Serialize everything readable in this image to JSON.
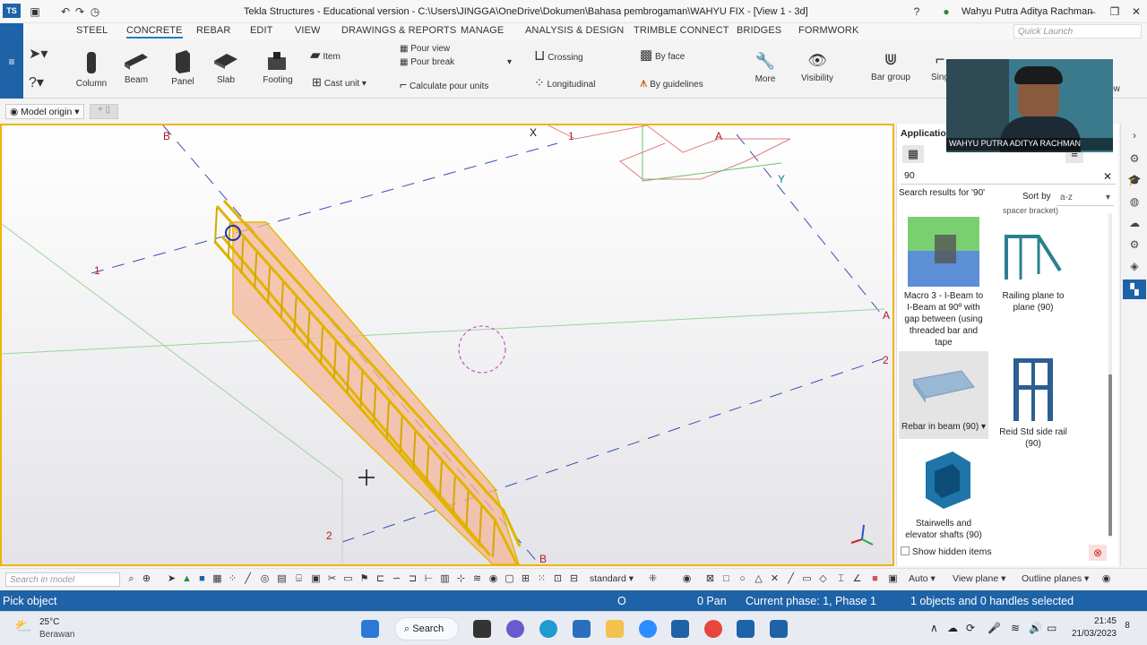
{
  "window": {
    "title": "Tekla Structures - Educational version - C:\\Users\\JINGGA\\OneDrive\\Dokumen\\Bahasa pembrogaman\\WAHYU FIX  - [View 1 - 3d]",
    "user": "Wahyu Putra Aditya Rachman"
  },
  "ribbon_tabs": [
    "STEEL",
    "CONCRETE",
    "REBAR",
    "EDIT",
    "VIEW",
    "DRAWINGS & REPORTS",
    "MANAGE",
    "ANALYSIS & DESIGN",
    "TRIMBLE CONNECT",
    "BRIDGES",
    "FORMWORK"
  ],
  "active_tab": "CONCRETE",
  "quick_launch_placeholder": "Quick Launch",
  "ribbon": {
    "column": "Column",
    "beam": "Beam",
    "panel": "Panel",
    "slab": "Slab",
    "footing": "Footing",
    "item": "Item",
    "cast_unit": "Cast unit",
    "pour_view": "Pour view",
    "pour_break": "Pour break",
    "calculate_pour_units": "Calculate pour units",
    "crossing": "Crossing",
    "longitudinal": "Longitudinal",
    "by_face": "By face",
    "by_guidelines": "By guidelines",
    "more": "More",
    "visibility": "Visibility",
    "bar_group": "Bar group",
    "single": "Sing",
    "window": "ndow"
  },
  "model_origin": "Model origin",
  "grid_labels": {
    "b_top": "B",
    "x_axis": "X",
    "one_top": "1",
    "a_top": "A",
    "y_axis": "Y",
    "one_left": "1",
    "a_right": "A",
    "two_right": "2",
    "two_bottom": "2",
    "b_bottom": "B"
  },
  "applications_panel": {
    "header": "Applications & components",
    "search_value": "90",
    "results_label": "Search results for '90'",
    "sort_label": "Sort by",
    "sort_value": "a-z",
    "partial_item": "spacer bracket)",
    "items": [
      "Macro 3 - I-Beam to I-Beam at 90º with gap between (using threaded bar and tape",
      "Railing plane to plane (90)",
      "Rebar in beam (90)",
      "Reid Std side rail (90)",
      "Stairwells and elevator shafts (90)"
    ],
    "show_hidden": "Show hidden items"
  },
  "webcam_name": "WAHYU PUTRA ADITYA RACHMAN",
  "bottom_toolbar": {
    "search_placeholder": "Search in model",
    "view_setting": "standard",
    "auto": "Auto",
    "view_plane": "View plane",
    "outline_planes": "Outline planes"
  },
  "status": {
    "prompt": "Pick object",
    "o": "O",
    "pan": "0  Pan",
    "phase": "Current phase: 1, Phase 1",
    "selection": "1 objects and 0 handles selected"
  },
  "taskbar": {
    "temp": "25°C",
    "weather": "Berawan",
    "search": "Search",
    "time": "21:45",
    "date": "21/03/2023"
  },
  "colors": {
    "accent": "#1e62a8",
    "viewport_border": "#f1b400",
    "rebar": "#e6b800",
    "concrete": "#f4b79a"
  }
}
